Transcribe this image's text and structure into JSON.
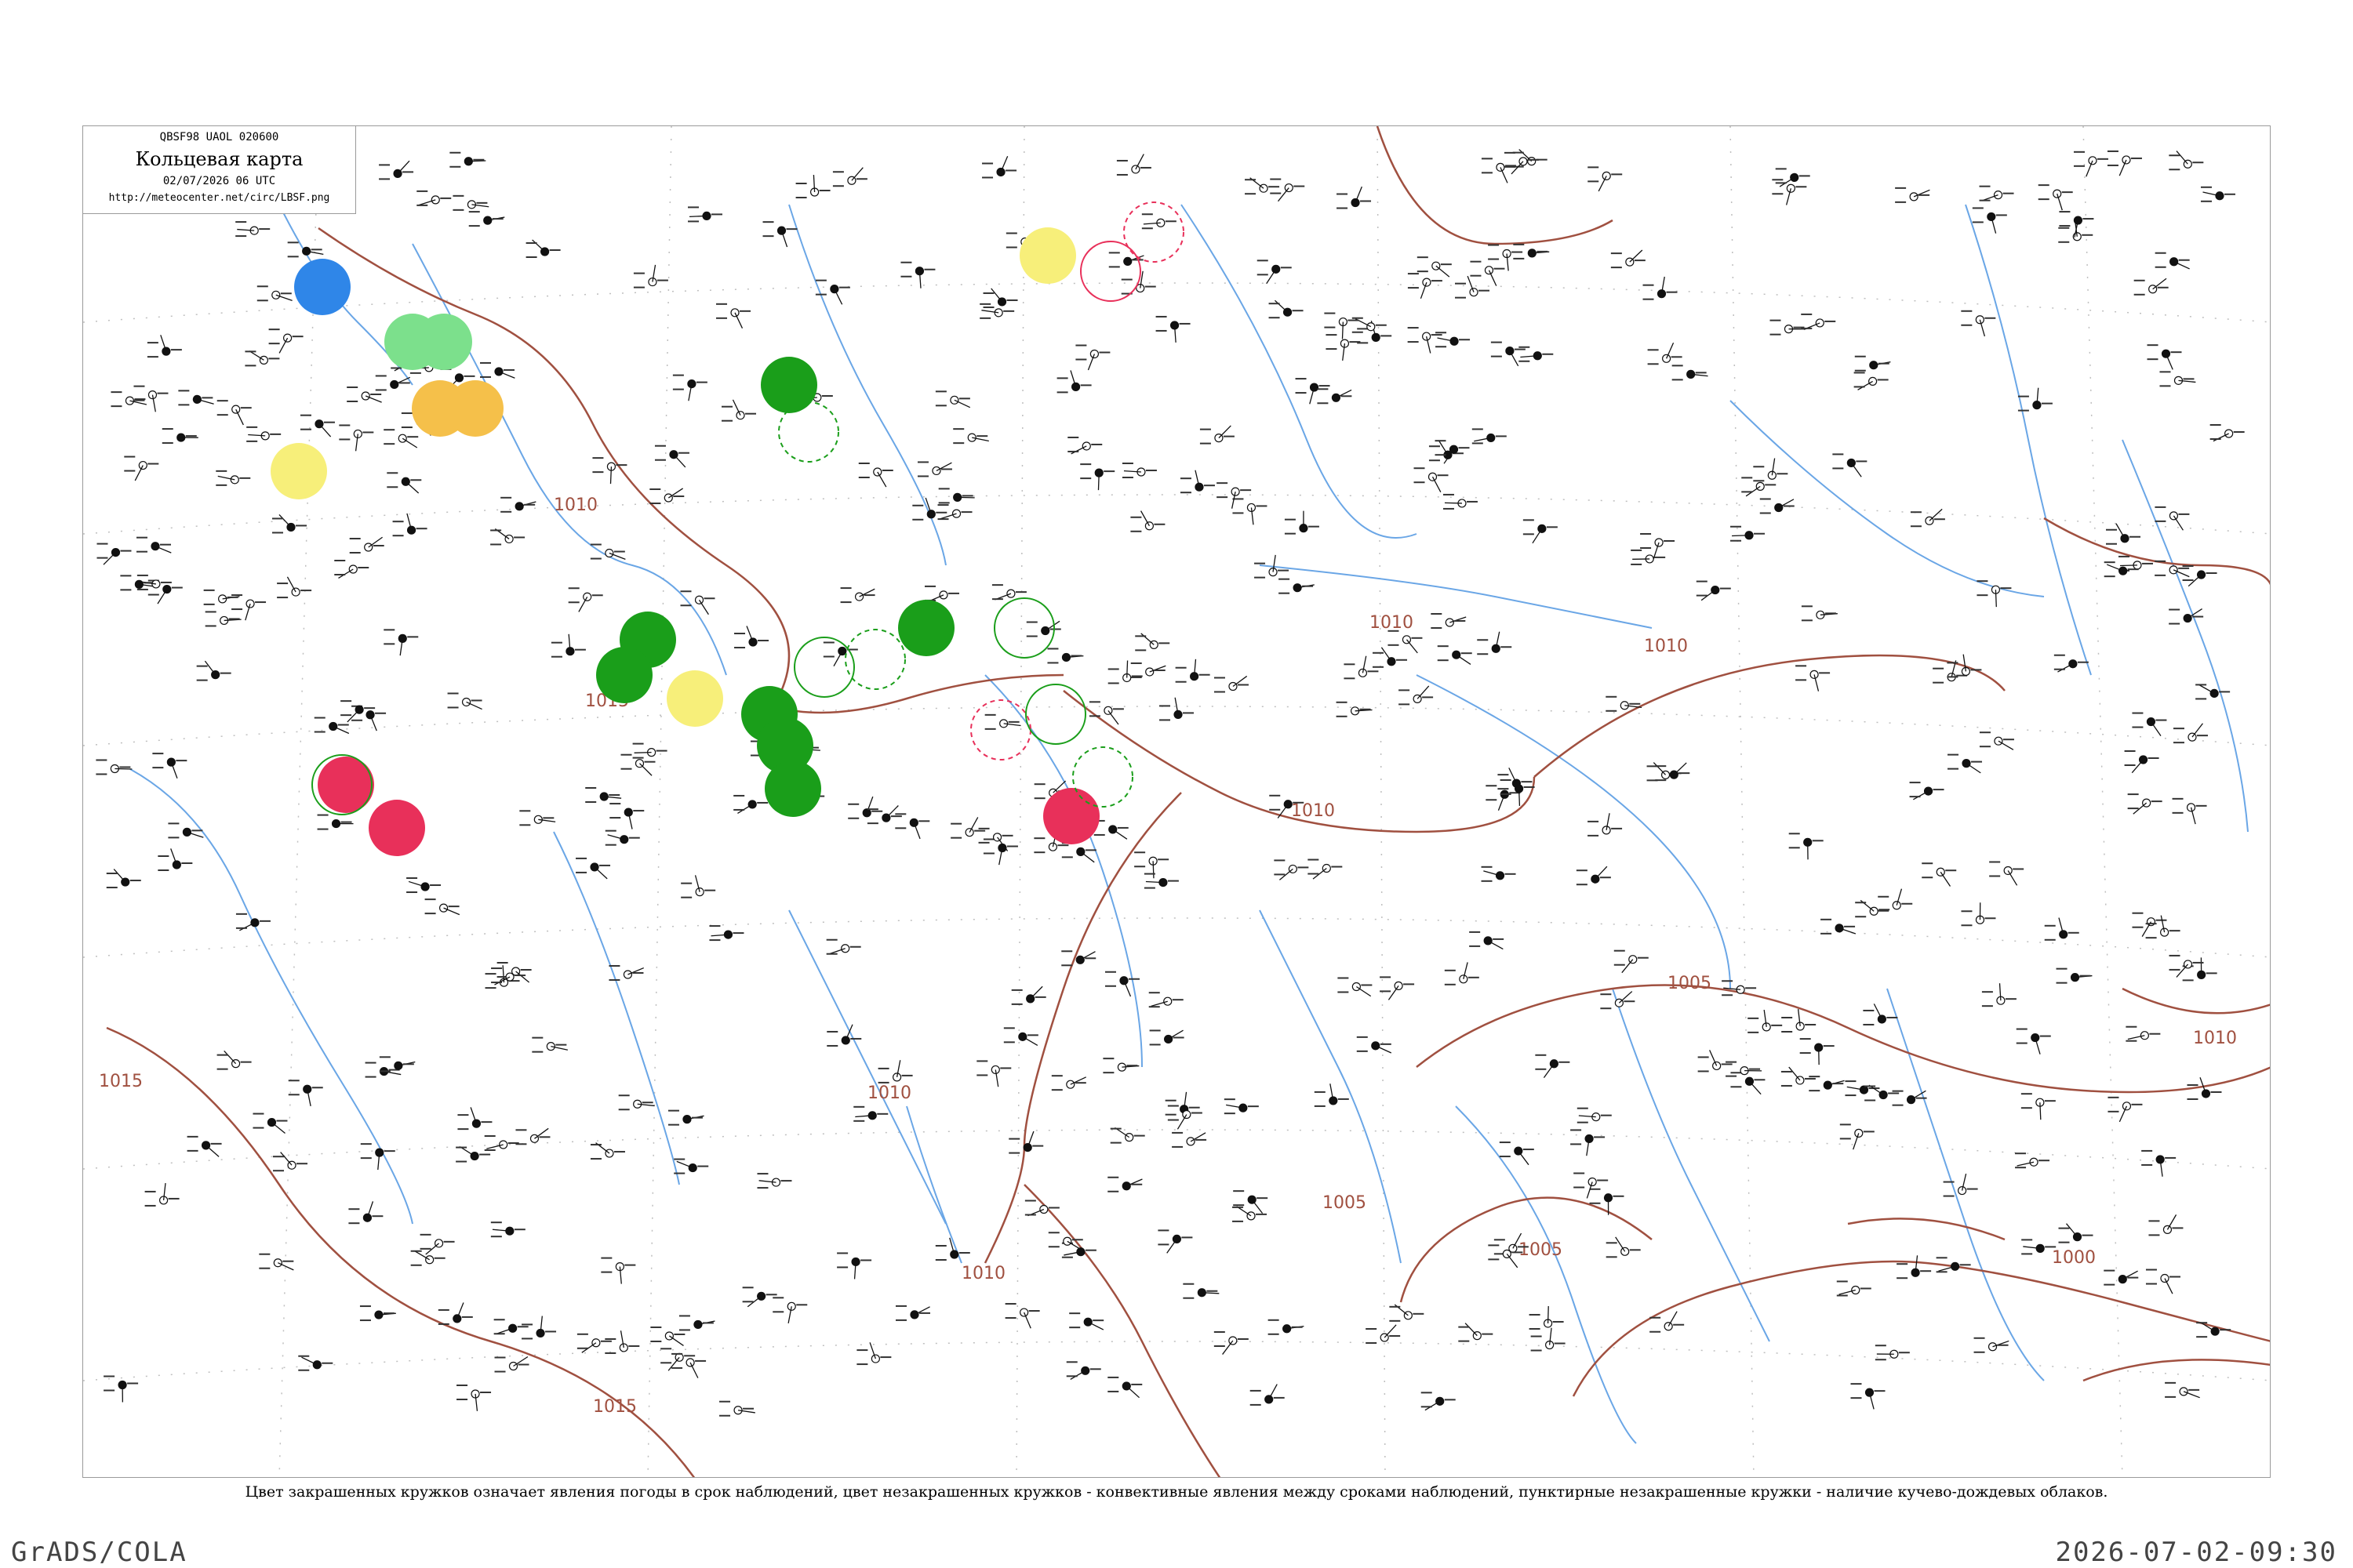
{
  "header": {
    "code": "QBSF98  UAOL  020600",
    "title": "Кольцевая карта",
    "date": "02/07/2026 06 UTC",
    "url": "http://meteocenter.net/circ/LBSF.png"
  },
  "caption": "Цвет закрашенных кружков означает явления погоды в срок наблюдений, цвет незакрашенных кружков - конвективные явления между сроками наблюдений, пунктирные незакрашенные кружки - наличие кучево-дождевых облаков.",
  "footer": {
    "left": "GrADS/COLA",
    "right": "2026-07-02-09:30"
  },
  "isobars": {
    "labels": [
      "1015",
      "1010",
      "1015",
      "1010",
      "1010",
      "1005",
      "1005",
      "1010",
      "1010",
      "1010",
      "1000",
      "1015",
      "1005",
      "1010"
    ]
  },
  "colors": {
    "isobar": "#a05040",
    "river": "#6aa6e6",
    "thunderstorm": "#1a9e1a",
    "rain": "#e8305a",
    "shower": "#7ce08c",
    "drizzle": "#f5c04a",
    "fog": "#f7ef7a",
    "snow_blue": "#2f86e8"
  },
  "markers": {
    "filled": [
      {
        "kind": "snow_blue"
      },
      {
        "kind": "shower"
      },
      {
        "kind": "shower"
      },
      {
        "kind": "drizzle"
      },
      {
        "kind": "drizzle"
      },
      {
        "kind": "fog"
      },
      {
        "kind": "thunderstorm"
      },
      {
        "kind": "thunderstorm"
      },
      {
        "kind": "thunderstorm"
      },
      {
        "kind": "fog"
      },
      {
        "kind": "thunderstorm"
      },
      {
        "kind": "thunderstorm"
      },
      {
        "kind": "thunderstorm"
      },
      {
        "kind": "thunderstorm"
      },
      {
        "kind": "rain"
      },
      {
        "kind": "rain"
      },
      {
        "kind": "rain"
      },
      {
        "kind": "fog"
      }
    ],
    "open": [
      {
        "kind": "thunderstorm"
      },
      {
        "kind": "thunderstorm"
      },
      {
        "kind": "thunderstorm"
      },
      {
        "kind": "thunderstorm"
      },
      {
        "kind": "rain"
      },
      {
        "kind": "rain"
      },
      {
        "kind": "rain"
      },
      {
        "kind": "thunderstorm"
      },
      {
        "kind": "thunderstorm"
      },
      {
        "kind": "thunderstorm"
      }
    ]
  }
}
